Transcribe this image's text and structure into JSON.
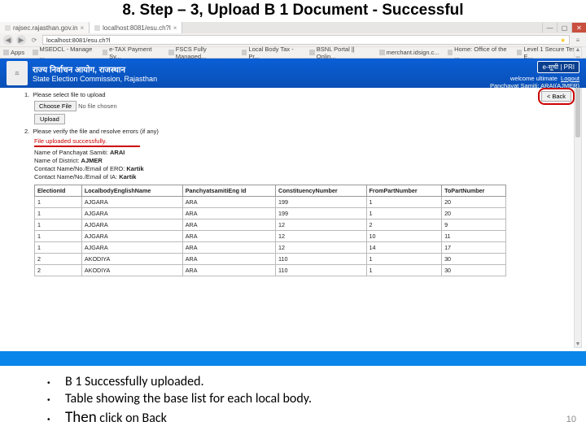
{
  "slide_title": "8. Step – 3, Upload B 1 Document - Successful",
  "browser": {
    "tabs": [
      {
        "label": "rajsec.rajasthan.gov.in",
        "active": false
      },
      {
        "label": "localhost:8081/esu.ch?l",
        "active": true
      }
    ],
    "window": {
      "min": "—",
      "max": "▢",
      "close": "✕"
    },
    "nav": {
      "back": "◀",
      "forward": "▶",
      "reload": "⟳"
    },
    "url": "localhost:8081/esu.ch?l",
    "star": "★",
    "menu": "≡",
    "bookmarks": [
      "Apps",
      "MSEDCL - Manage ...",
      "e-TAX Payment Sy...",
      "FSCS Fully Managed...",
      "Local Body Tax - Pr...",
      "BSNL Portal || Onlin...",
      "merchant.idsign.c...",
      "Home: Office of the ...",
      "Level 1 Secure Test E..."
    ]
  },
  "header": {
    "hindi": "राज्य निर्वाचन आयोग, राजस्थान",
    "english": "State Election Commission, Rajasthan",
    "esuchi": "e-सूची | PRI",
    "welcome": "welcome ultimate",
    "logout": "Logout",
    "role": "Panchayat Samiti: ARAI(AJMER)"
  },
  "content": {
    "back": "< Back",
    "step1_num": "1.",
    "step1_text": "Please select file to upload",
    "choose_file": "Choose File",
    "no_file": "No file chosen",
    "upload": "Upload",
    "step2_num": "2.",
    "step2_text": "Please verify the file and resolve errors (if any)",
    "success": "File uploaded successfully.",
    "meta": {
      "samiti_label": "Name of Panchayat Samiti:",
      "samiti_value": "ARAI",
      "district_label": "Name of District:",
      "district_value": "AJMER",
      "ero_label": "Contact Name/No./Email of ERO:",
      "ero_value": "Kartik",
      "ia_label": "Contact Name/No./Email of IA:",
      "ia_value": "Kartik"
    },
    "table": {
      "headers": [
        "ElectionId",
        "LocalbodyEnglishName",
        "PanchyatsamitiEng Id",
        "ConstituencyNumber",
        "FromPartNumber",
        "ToPartNumber"
      ],
      "rows": [
        [
          "1",
          "AJGARA",
          "ARA",
          "199",
          "1",
          "20"
        ],
        [
          "1",
          "AJGARA",
          "ARA",
          "199",
          "1",
          "20"
        ],
        [
          "1",
          "AJGARA",
          "ARA",
          "12",
          "2",
          "9"
        ],
        [
          "1",
          "AJGARA",
          "ARA",
          "12",
          "10",
          "11"
        ],
        [
          "1",
          "AJGARA",
          "ARA",
          "12",
          "14",
          "17"
        ],
        [
          "2",
          "AKODIYA",
          "ARA",
          "110",
          "1",
          "30"
        ],
        [
          "2",
          "AKODIYA",
          "ARA",
          "110",
          "1",
          "30"
        ]
      ]
    }
  },
  "bullets": {
    "b1": "B 1 Successfully uploaded.",
    "b2": "Table showing the base list for each local body.",
    "b3_then": "Then",
    "b3_rest": " click on Back"
  },
  "page_number": "10"
}
